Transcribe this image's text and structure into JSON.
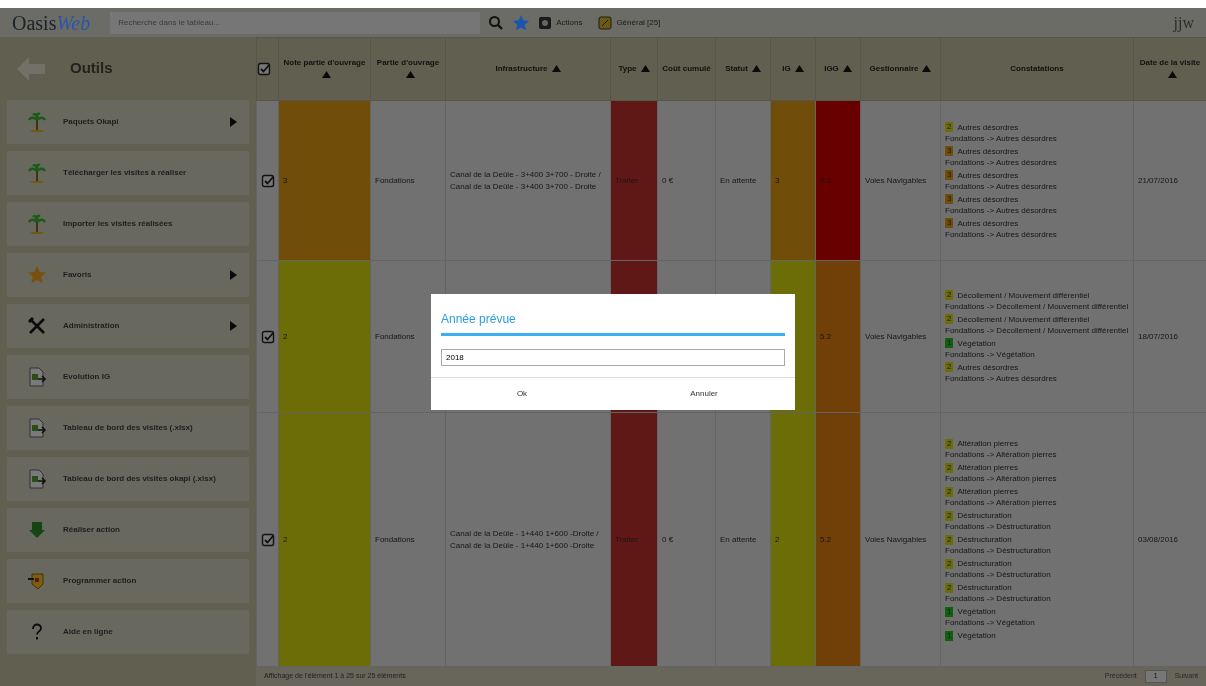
{
  "topbar": {
    "logo_main": "Oasis",
    "logo_accent": "Web",
    "search": {
      "placeholder": "Recherche dans le tableau..."
    },
    "actions": "Actions",
    "general": "Général [25]",
    "user": "jjw"
  },
  "sidebar": {
    "title": "Outils",
    "items": [
      {
        "kind": "palm",
        "label": "Paquets Okapi",
        "submenu": true
      },
      {
        "kind": "palm",
        "label": "Télécharger les visites à réaliser",
        "submenu": false
      },
      {
        "kind": "palm",
        "label": "Importer les visites réalisées",
        "submenu": false
      },
      {
        "kind": "star",
        "label": "Favoris",
        "submenu": true
      },
      {
        "kind": "tools",
        "label": "Administration",
        "submenu": true
      },
      {
        "kind": "sheet",
        "label": "Evolution IG",
        "submenu": false
      },
      {
        "kind": "sheet",
        "label": "Tableau de bord des visites (.xlsx)",
        "submenu": false
      },
      {
        "kind": "sheet",
        "label": "Tableau de bord des visites okapi (.xlsx)",
        "submenu": false
      },
      {
        "kind": "down",
        "label": "Réaliser action",
        "submenu": false
      },
      {
        "kind": "flag",
        "label": "Programmer action",
        "submenu": false
      },
      {
        "kind": "help",
        "label": "Aide en ligne",
        "submenu": false
      }
    ]
  },
  "table": {
    "all_checked": true,
    "columns": [
      {
        "label": "Note partie d'ouvrage",
        "sort": true
      },
      {
        "label": "Partie d'ouvrage",
        "sort": true
      },
      {
        "label": "Infrastructure",
        "sort": true
      },
      {
        "label": "Type",
        "sort": true
      },
      {
        "label": "Coût cumulé",
        "sort": false
      },
      {
        "label": "Statut",
        "sort": true
      },
      {
        "label": "IG",
        "sort": true
      },
      {
        "label": "IGG",
        "sort": true
      },
      {
        "label": "Gestionnaire",
        "sort": true
      },
      {
        "label": "Constatations",
        "sort": false
      },
      {
        "label": "Date de la visite",
        "sort": true
      }
    ],
    "rows": [
      {
        "checked": true,
        "note": {
          "text": "3",
          "color": "#704d08"
        },
        "partie": "Fondations",
        "infrastructure": "Canal de la Deûle - 3+400 3+700 - Droite / Canal de la Deûle - 3+400 3+700 - Droite",
        "type": {
          "text": "Traiter",
          "color": "#601817"
        },
        "cout": "0 €",
        "statut": "En attente",
        "ig": {
          "text": "3",
          "color": "#704d08"
        },
        "igg": {
          "text": "5.2",
          "color": "#680000"
        },
        "gestionnaire": "Voies Navigables",
        "date": "21/07/2016",
        "constatations": [
          {
            "badge": "2",
            "color": "#6d6d08",
            "title": "Autres désordres",
            "path": "Fondations -> Autres désordres"
          },
          {
            "badge": "3",
            "color": "#704d08",
            "title": "Autres désordres",
            "path": "Fondations -> Autres désordres"
          },
          {
            "badge": "3",
            "color": "#704d08",
            "title": "Autres désordres",
            "path": "Fondations -> Autres désordres"
          },
          {
            "badge": "3",
            "color": "#704d08",
            "title": "Autres désordres",
            "path": "Fondations -> Autres désordres"
          },
          {
            "badge": "3",
            "color": "#704d08",
            "title": "Autres désordres",
            "path": "Fondations -> Autres désordres"
          }
        ]
      },
      {
        "checked": true,
        "note": {
          "text": "2",
          "color": "#6d6d08"
        },
        "partie": "Fondations",
        "type": {
          "color": "#601817"
        },
        "ig": {
          "color": "#6d6d08"
        },
        "igg": {
          "text": "5.2",
          "color": "#704008"
        },
        "gestionnaire": "Voies Navigables",
        "date": "18/07/2016",
        "constatations": [
          {
            "badge": "2",
            "color": "#6d6d08",
            "title": "Décollement / Mouvement différentiel",
            "path": "Fondations -> Décollement / Mouvement différentiel"
          },
          {
            "badge": "2",
            "color": "#6d6d08",
            "title": "Décollement / Mouvement différentiel",
            "path": "Fondations -> Décollement / Mouvement différentiel"
          },
          {
            "badge": "1",
            "color": "#106010",
            "title": "Végétation",
            "path": "Fondations -> Végétation"
          },
          {
            "badge": "2",
            "color": "#6d6d08",
            "title": "Autres désordres",
            "path": "Fondations -> Autres désordres"
          }
        ]
      },
      {
        "checked": true,
        "note": {
          "text": "2",
          "color": "#6d6d08"
        },
        "partie": "Fondations",
        "infrastructure": "Canal de la Deûle - 1+440 1+600 -Droite / Canal de la Deûle - 1+440 1+600 -Droite",
        "type": {
          "text": "Traiter",
          "color": "#601817"
        },
        "cout": "0 €",
        "statut": "En attente",
        "ig": {
          "text": "2",
          "color": "#6d6d08"
        },
        "igg": {
          "text": "5.2",
          "color": "#704008"
        },
        "gestionnaire": "Voies Navigables",
        "date": "03/08/2016",
        "constatations": [
          {
            "badge": "2",
            "color": "#6d6d08",
            "title": "Altération pierres",
            "path": "Fondations -> Altération pierres"
          },
          {
            "badge": "2",
            "color": "#6d6d08",
            "title": "Altération pierres",
            "path": "Fondations -> Altération pierres"
          },
          {
            "badge": "2",
            "color": "#6d6d08",
            "title": "Altération pierres",
            "path": "Fondations -> Altération pierres"
          },
          {
            "badge": "2",
            "color": "#6d6d08",
            "title": "Déstructuration",
            "path": "Fondations -> Déstructuration"
          },
          {
            "badge": "2",
            "color": "#6d6d08",
            "title": "Déstructuration",
            "path": "Fondations -> Déstructuration"
          },
          {
            "badge": "2",
            "color": "#6d6d08",
            "title": "Déstructuration",
            "path": "Fondations -> Déstructuration"
          },
          {
            "badge": "2",
            "color": "#6d6d08",
            "title": "Déstructuration",
            "path": "Fondations -> Déstructuration"
          },
          {
            "badge": "1",
            "color": "#106010",
            "title": "Végétation",
            "path": "Fondations -> Végétation"
          },
          {
            "badge": "1",
            "color": "#106010",
            "title": "Végétation"
          }
        ]
      }
    ]
  },
  "footer": {
    "info": "Affichage de l'élément 1 à 25 sur 25 éléments",
    "previous": "Précédent",
    "page": "1",
    "next": "Suivant"
  },
  "dialog": {
    "title": "Année prévue",
    "value": "2018",
    "buttons": [
      "Ok",
      "Annuler"
    ]
  }
}
